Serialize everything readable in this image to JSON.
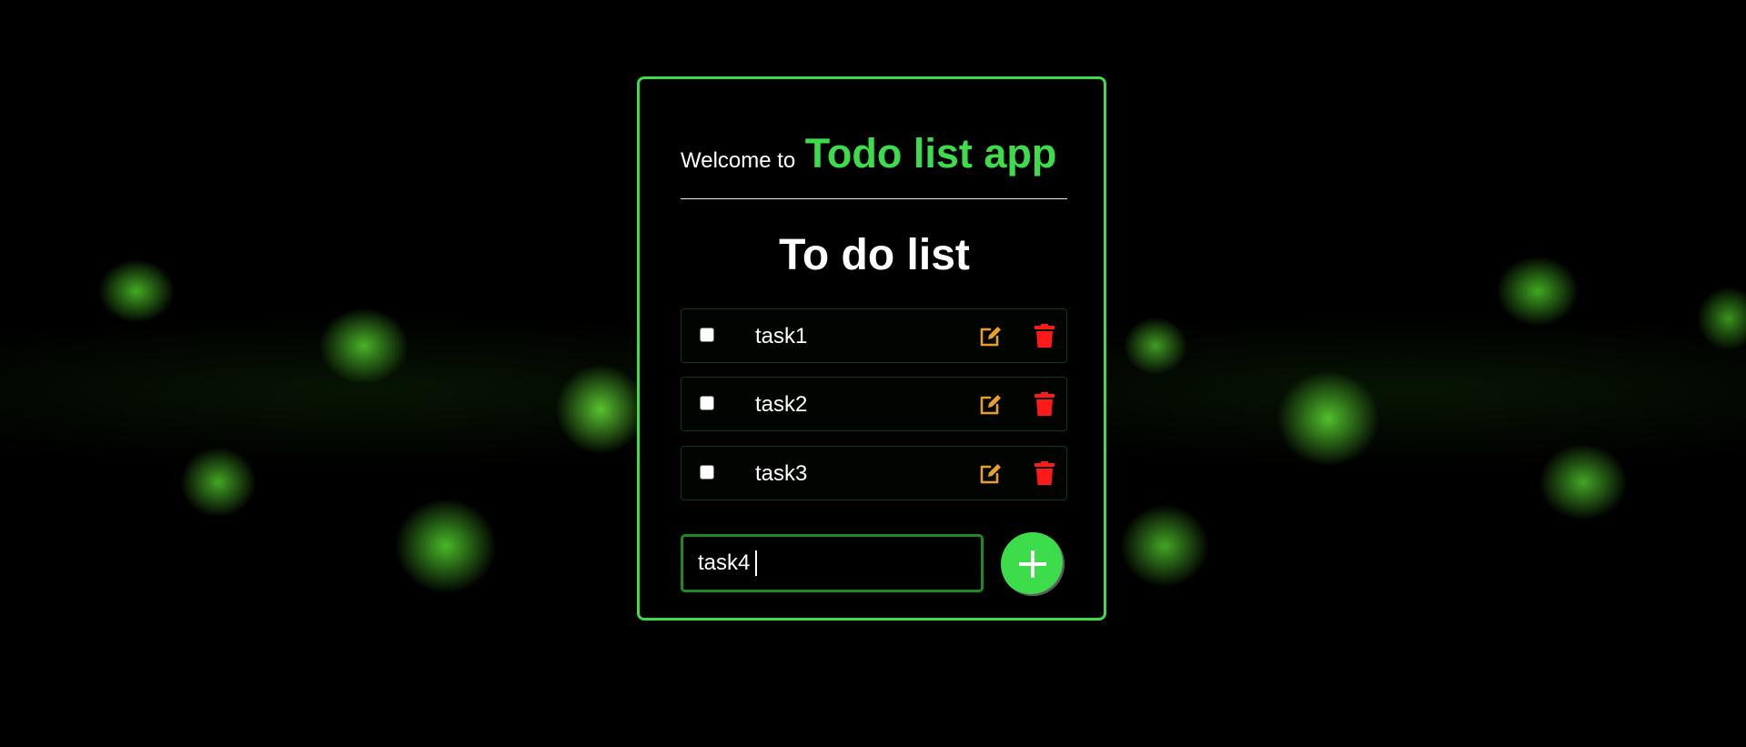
{
  "colors": {
    "accent": "#3ddc4a",
    "edit_icon": "#e8a02c",
    "delete_icon": "#ff1a1a",
    "background": "#000000"
  },
  "header": {
    "welcome_prefix": "Welcome to",
    "app_name": "Todo list app"
  },
  "list": {
    "title": "To do list",
    "tasks": [
      {
        "label": "task1",
        "checked": false,
        "edit_icon": "edit-icon",
        "delete_icon": "trash-icon"
      },
      {
        "label": "task2",
        "checked": false,
        "edit_icon": "edit-icon",
        "delete_icon": "trash-icon"
      },
      {
        "label": "task3",
        "checked": false,
        "edit_icon": "edit-icon",
        "delete_icon": "trash-icon"
      }
    ]
  },
  "new_task": {
    "value": "task4",
    "add_icon": "plus-icon"
  }
}
